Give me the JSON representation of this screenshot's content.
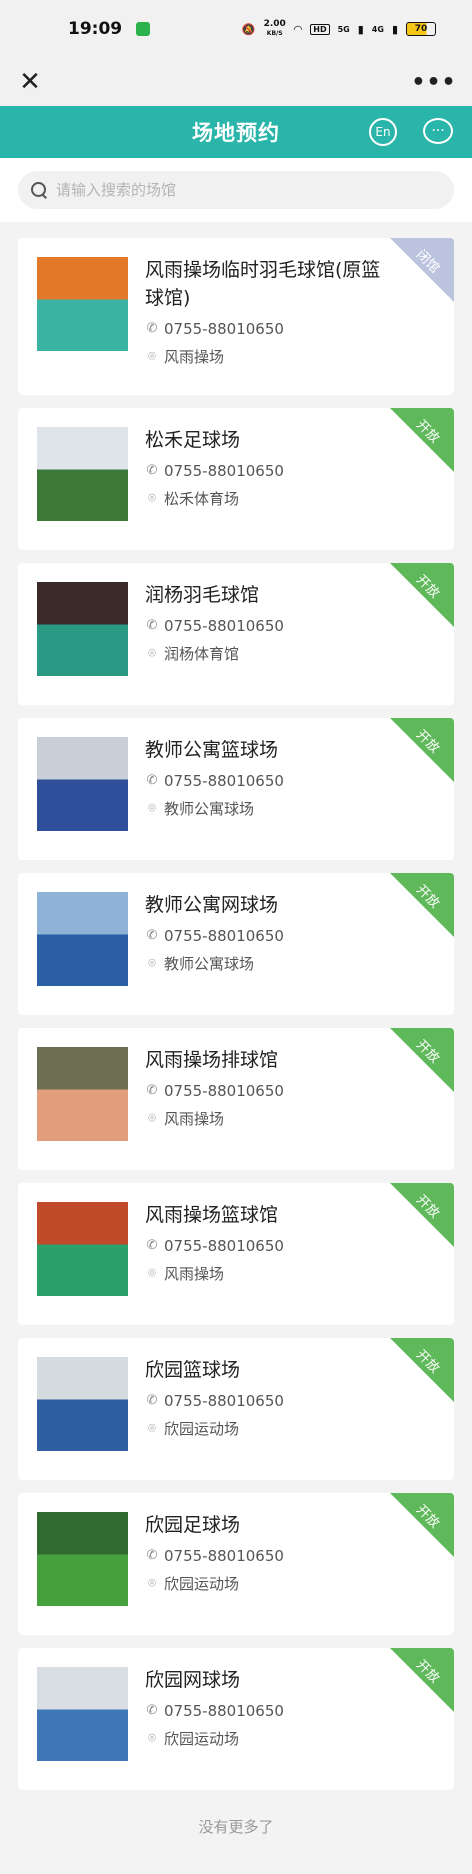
{
  "status_bar": {
    "time": "19:09",
    "net_speed": "2.00",
    "net_speed_unit": "KB/S",
    "hd_label": "HD",
    "signal1": "5G",
    "signal2": "4G",
    "battery": "70"
  },
  "nav": {
    "close_icon": "close-icon",
    "more_icon": "more-icon"
  },
  "header": {
    "title": "场地预约",
    "lang_label": "En"
  },
  "search": {
    "placeholder": "请输入搜索的场馆"
  },
  "venues": [
    {
      "name": "风雨操场临时羽毛球馆(原篮球馆)",
      "phone": "0755-88010650",
      "location": "风雨操场",
      "status": "闭馆",
      "status_type": "closed",
      "thumb_colors": [
        "#e2782a",
        "#3bb3a2"
      ]
    },
    {
      "name": "松禾足球场",
      "phone": "0755-88010650",
      "location": "松禾体育场",
      "status": "开放",
      "status_type": "open",
      "thumb_colors": [
        "#dfe4ea",
        "#3d7a3a"
      ]
    },
    {
      "name": "润杨羽毛球馆",
      "phone": "0755-88010650",
      "location": "润杨体育馆",
      "status": "开放",
      "status_type": "open",
      "thumb_colors": [
        "#3a2a2a",
        "#2a9a84"
      ]
    },
    {
      "name": "教师公寓篮球场",
      "phone": "0755-88010650",
      "location": "教师公寓球场",
      "status": "开放",
      "status_type": "open",
      "thumb_colors": [
        "#c9cfd6",
        "#2f4f9b"
      ]
    },
    {
      "name": "教师公寓网球场",
      "phone": "0755-88010650",
      "location": "教师公寓球场",
      "status": "开放",
      "status_type": "open",
      "thumb_colors": [
        "#8fb2d9",
        "#2b5fa6"
      ]
    },
    {
      "name": "风雨操场排球馆",
      "phone": "0755-88010650",
      "location": "风雨操场",
      "status": "开放",
      "status_type": "open",
      "thumb_colors": [
        "#6c6f52",
        "#e29d7c"
      ]
    },
    {
      "name": "风雨操场篮球馆",
      "phone": "0755-88010650",
      "location": "风雨操场",
      "status": "开放",
      "status_type": "open",
      "thumb_colors": [
        "#c04a2a",
        "#2aa06a"
      ]
    },
    {
      "name": "欣园篮球场",
      "phone": "0755-88010650",
      "location": "欣园运动场",
      "status": "开放",
      "status_type": "open",
      "thumb_colors": [
        "#d6dbe0",
        "#2f5ea2"
      ]
    },
    {
      "name": "欣园足球场",
      "phone": "0755-88010650",
      "location": "欣园运动场",
      "status": "开放",
      "status_type": "open",
      "thumb_colors": [
        "#2f6a2f",
        "#46a13c"
      ]
    },
    {
      "name": "欣园网球场",
      "phone": "0755-88010650",
      "location": "欣园运动场",
      "status": "开放",
      "status_type": "open",
      "thumb_colors": [
        "#d8dee4",
        "#3d77b8"
      ]
    }
  ],
  "footer": {
    "no_more": "没有更多了"
  },
  "colors": {
    "header": "#2ab5aa",
    "open": "#5fb85a",
    "closed": "#bcc3df"
  }
}
